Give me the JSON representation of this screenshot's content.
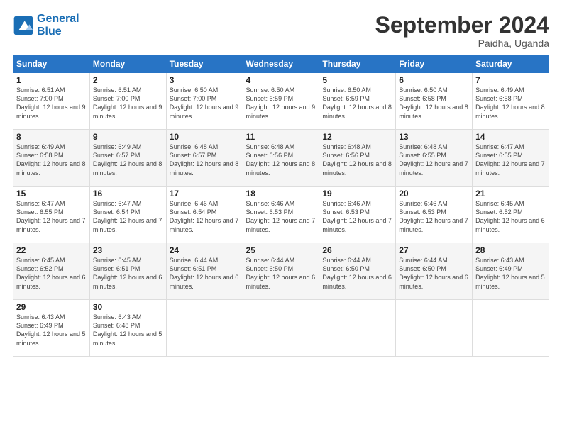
{
  "header": {
    "logo_line1": "General",
    "logo_line2": "Blue",
    "month": "September 2024",
    "location": "Paidha, Uganda"
  },
  "days_of_week": [
    "Sunday",
    "Monday",
    "Tuesday",
    "Wednesday",
    "Thursday",
    "Friday",
    "Saturday"
  ],
  "weeks": [
    [
      {
        "day": "1",
        "sunrise": "6:51 AM",
        "sunset": "7:00 PM",
        "daylight": "12 hours and 9 minutes."
      },
      {
        "day": "2",
        "sunrise": "6:51 AM",
        "sunset": "7:00 PM",
        "daylight": "12 hours and 9 minutes."
      },
      {
        "day": "3",
        "sunrise": "6:50 AM",
        "sunset": "7:00 PM",
        "daylight": "12 hours and 9 minutes."
      },
      {
        "day": "4",
        "sunrise": "6:50 AM",
        "sunset": "6:59 PM",
        "daylight": "12 hours and 9 minutes."
      },
      {
        "day": "5",
        "sunrise": "6:50 AM",
        "sunset": "6:59 PM",
        "daylight": "12 hours and 8 minutes."
      },
      {
        "day": "6",
        "sunrise": "6:50 AM",
        "sunset": "6:58 PM",
        "daylight": "12 hours and 8 minutes."
      },
      {
        "day": "7",
        "sunrise": "6:49 AM",
        "sunset": "6:58 PM",
        "daylight": "12 hours and 8 minutes."
      }
    ],
    [
      {
        "day": "8",
        "sunrise": "6:49 AM",
        "sunset": "6:58 PM",
        "daylight": "12 hours and 8 minutes."
      },
      {
        "day": "9",
        "sunrise": "6:49 AM",
        "sunset": "6:57 PM",
        "daylight": "12 hours and 8 minutes."
      },
      {
        "day": "10",
        "sunrise": "6:48 AM",
        "sunset": "6:57 PM",
        "daylight": "12 hours and 8 minutes."
      },
      {
        "day": "11",
        "sunrise": "6:48 AM",
        "sunset": "6:56 PM",
        "daylight": "12 hours and 8 minutes."
      },
      {
        "day": "12",
        "sunrise": "6:48 AM",
        "sunset": "6:56 PM",
        "daylight": "12 hours and 8 minutes."
      },
      {
        "day": "13",
        "sunrise": "6:48 AM",
        "sunset": "6:55 PM",
        "daylight": "12 hours and 7 minutes."
      },
      {
        "day": "14",
        "sunrise": "6:47 AM",
        "sunset": "6:55 PM",
        "daylight": "12 hours and 7 minutes."
      }
    ],
    [
      {
        "day": "15",
        "sunrise": "6:47 AM",
        "sunset": "6:55 PM",
        "daylight": "12 hours and 7 minutes."
      },
      {
        "day": "16",
        "sunrise": "6:47 AM",
        "sunset": "6:54 PM",
        "daylight": "12 hours and 7 minutes."
      },
      {
        "day": "17",
        "sunrise": "6:46 AM",
        "sunset": "6:54 PM",
        "daylight": "12 hours and 7 minutes."
      },
      {
        "day": "18",
        "sunrise": "6:46 AM",
        "sunset": "6:53 PM",
        "daylight": "12 hours and 7 minutes."
      },
      {
        "day": "19",
        "sunrise": "6:46 AM",
        "sunset": "6:53 PM",
        "daylight": "12 hours and 7 minutes."
      },
      {
        "day": "20",
        "sunrise": "6:46 AM",
        "sunset": "6:53 PM",
        "daylight": "12 hours and 7 minutes."
      },
      {
        "day": "21",
        "sunrise": "6:45 AM",
        "sunset": "6:52 PM",
        "daylight": "12 hours and 6 minutes."
      }
    ],
    [
      {
        "day": "22",
        "sunrise": "6:45 AM",
        "sunset": "6:52 PM",
        "daylight": "12 hours and 6 minutes."
      },
      {
        "day": "23",
        "sunrise": "6:45 AM",
        "sunset": "6:51 PM",
        "daylight": "12 hours and 6 minutes."
      },
      {
        "day": "24",
        "sunrise": "6:44 AM",
        "sunset": "6:51 PM",
        "daylight": "12 hours and 6 minutes."
      },
      {
        "day": "25",
        "sunrise": "6:44 AM",
        "sunset": "6:50 PM",
        "daylight": "12 hours and 6 minutes."
      },
      {
        "day": "26",
        "sunrise": "6:44 AM",
        "sunset": "6:50 PM",
        "daylight": "12 hours and 6 minutes."
      },
      {
        "day": "27",
        "sunrise": "6:44 AM",
        "sunset": "6:50 PM",
        "daylight": "12 hours and 6 minutes."
      },
      {
        "day": "28",
        "sunrise": "6:43 AM",
        "sunset": "6:49 PM",
        "daylight": "12 hours and 5 minutes."
      }
    ],
    [
      {
        "day": "29",
        "sunrise": "6:43 AM",
        "sunset": "6:49 PM",
        "daylight": "12 hours and 5 minutes."
      },
      {
        "day": "30",
        "sunrise": "6:43 AM",
        "sunset": "6:48 PM",
        "daylight": "12 hours and 5 minutes."
      },
      {
        "day": "",
        "sunrise": "",
        "sunset": "",
        "daylight": ""
      },
      {
        "day": "",
        "sunrise": "",
        "sunset": "",
        "daylight": ""
      },
      {
        "day": "",
        "sunrise": "",
        "sunset": "",
        "daylight": ""
      },
      {
        "day": "",
        "sunrise": "",
        "sunset": "",
        "daylight": ""
      },
      {
        "day": "",
        "sunrise": "",
        "sunset": "",
        "daylight": ""
      }
    ]
  ]
}
